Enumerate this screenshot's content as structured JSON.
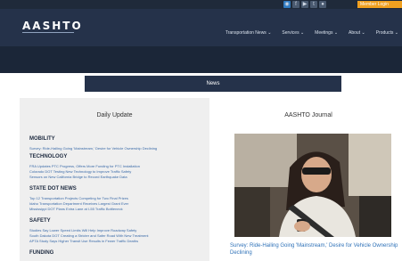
{
  "topbar": {
    "social_icons": [
      "rss-icon",
      "facebook-icon",
      "youtube-icon",
      "twitter-icon",
      "flickr-icon"
    ],
    "signin_label": "Member Login"
  },
  "header": {
    "logo_text": "AASHTO",
    "nav": [
      "Transportation News ⌄",
      "Services ⌄",
      "Meetings ⌄",
      "About ⌄",
      "Products ⌄"
    ]
  },
  "news_heading": "News",
  "daily_update": {
    "title": "Daily Update",
    "sections": [
      {
        "name": "MOBILITY",
        "items": [
          "Survey: Ride-Hailing Going 'Mainstream,' Desire for Vehicle Ownership Declining"
        ]
      },
      {
        "name": "TECHNOLOGY",
        "items": [
          "FRA Updates PTC Progress, Offers More Funding for PTC Installation",
          "Colorado DOT Testing New Technology to Improve Traffic Safety",
          "Sensors on New California Bridge to Record Earthquake Data"
        ]
      },
      {
        "name": "STATE DOT NEWS",
        "items": [
          "Top 12 Transportation Projects Competing for Two Final Prizes",
          "Idaho Transportation Department Receives Largest Grant Ever",
          "Mississippi DOT Plans Extra Lane at I-55 Traffic Bottleneck"
        ]
      },
      {
        "name": "SAFETY",
        "items": [
          "Studies Say Lower Speed Limits Will Help Improve Roadway Safety",
          "South Dakota DOT Creating a Stricter and Safer Road With New Treatment",
          "APTA Study Says Higher Transit Use Results in Fewer Traffic Deaths"
        ]
      },
      {
        "name": "FUNDING",
        "items": []
      }
    ]
  },
  "journal": {
    "title": "AASHTO Journal",
    "caption": "Survey: Ride-Hailing Going 'Mainstream,' Desire for Vehicle Ownership Declining"
  },
  "colors": {
    "header_navy": "#25324a",
    "dark_band": "#1b2638",
    "link_blue": "#2f72b8",
    "signin_orange": "#f0a020"
  }
}
